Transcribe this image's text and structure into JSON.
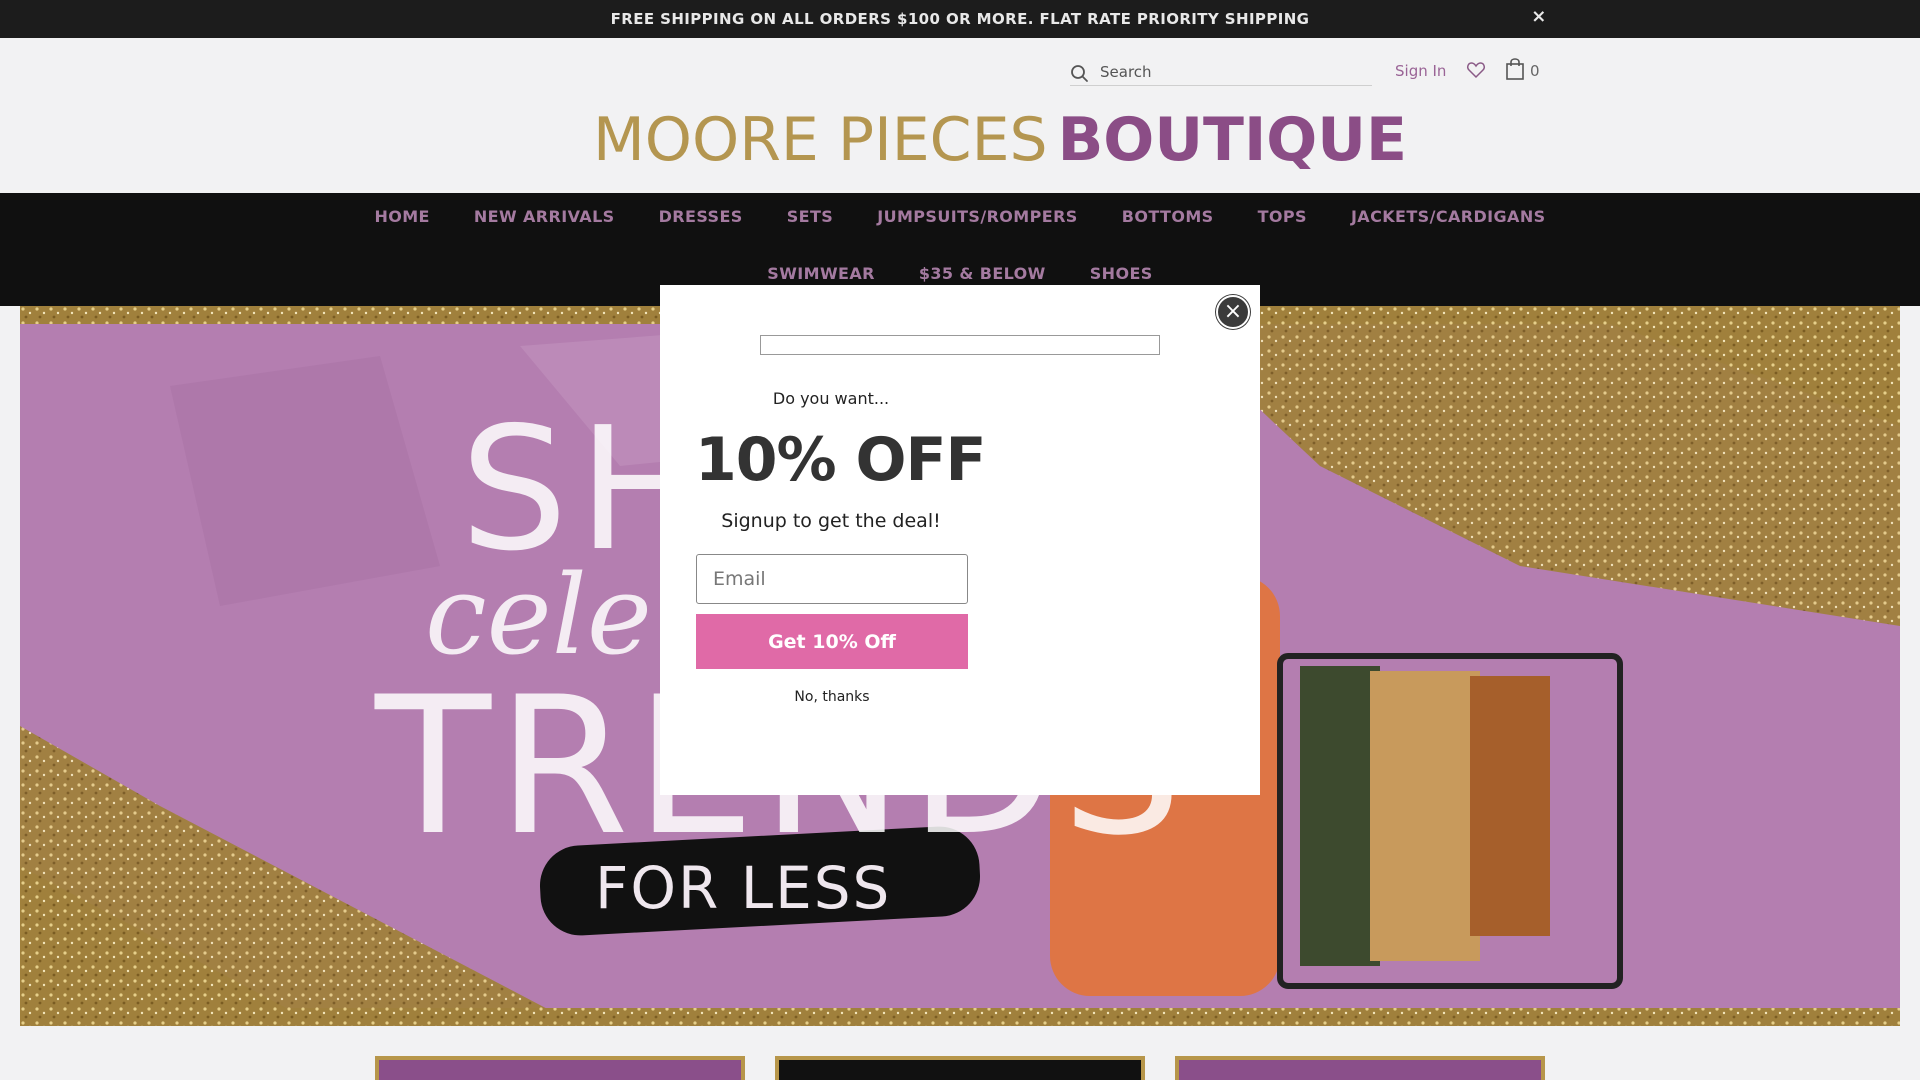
{
  "announcement": {
    "text": "FREE SHIPPING ON ALL ORDERS $100 OR MORE. FLAT RATE PRIORITY SHIPPING",
    "close_icon": "×"
  },
  "header": {
    "search_placeholder": "Search",
    "sign_in": "Sign In",
    "cart_count": "0",
    "logo_light": "MOORE PIECES",
    "logo_bold": "BOUTIQUE",
    "colors": {
      "logo_gold": "#b49650",
      "logo_purple": "#8b4d86",
      "nav_text": "#a47aa0"
    }
  },
  "nav": {
    "row1": [
      "HOME",
      "NEW ARRIVALS",
      "DRESSES",
      "SETS",
      "JUMPSUITS/ROMPERS",
      "BOTTOMS",
      "TOPS",
      "JACKETS/CARDIGANS"
    ],
    "row2": [
      "SWIMWEAR",
      "$35 & BELOW",
      "SHOES"
    ]
  },
  "hero": {
    "line1": "SH",
    "line2": "cele",
    "line3": "TRENDS",
    "line4": "FOR LESS"
  },
  "modal": {
    "pretitle": "Do you want...",
    "title": "10% OFF",
    "subtitle": "Signup to get the deal!",
    "email_placeholder": "Email",
    "button_label": "Get 10% Off",
    "decline": "No, thanks",
    "close_icon": "×",
    "button_color": "#e06aa7"
  }
}
